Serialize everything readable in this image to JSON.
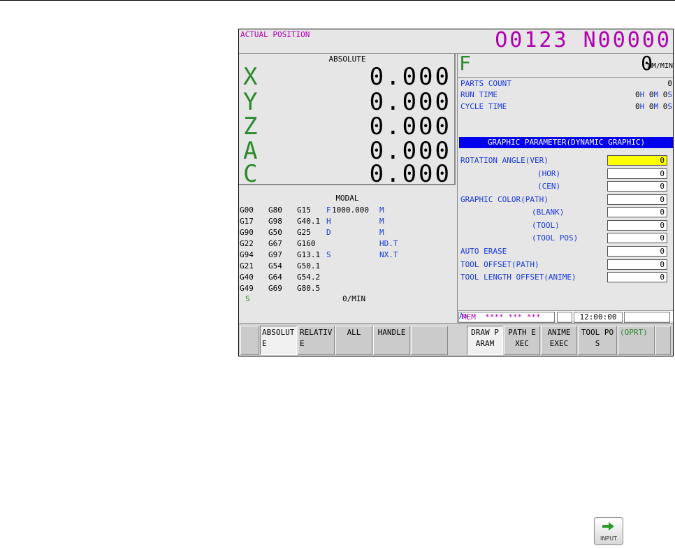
{
  "header": {
    "title": "ACTUAL POSITION",
    "program": "O0123 N00000"
  },
  "absolute": {
    "title": "ABSOLUTE",
    "axes": [
      {
        "name": "X",
        "value": "0.000"
      },
      {
        "name": "Y",
        "value": "0.000"
      },
      {
        "name": "Z",
        "value": "0.000"
      },
      {
        "name": "A",
        "value": "0.000"
      },
      {
        "name": "C",
        "value": "0.000"
      }
    ]
  },
  "modal": {
    "title": "MODAL",
    "rows": [
      [
        "G00",
        "G80",
        "G15"
      ],
      [
        "G17",
        "G98",
        "G40.1"
      ],
      [
        "G90",
        "G50",
        "G25"
      ],
      [
        "G22",
        "G67",
        "G160"
      ],
      [
        "G94",
        "G97",
        "G13.1"
      ],
      [
        "G21",
        "G54",
        "G50.1"
      ],
      [
        "G40",
        "G64",
        "G54.2"
      ],
      [
        "G49",
        "G69",
        "G80.5"
      ]
    ],
    "col4": [
      "F",
      "H",
      "D",
      "",
      "S"
    ],
    "feed_value": "1000.000",
    "col5": [
      "M",
      "M",
      "M",
      "HD.T",
      "NX.T"
    ],
    "s_label": "S",
    "speed_unit": "0/MIN"
  },
  "feed": {
    "label": "F",
    "value": "0",
    "unit": "MM/MIN"
  },
  "info": {
    "parts_count_label": "PARTS COUNT",
    "parts_count_value": "0",
    "run_time_label": "RUN TIME",
    "run_time": {
      "h": "0",
      "m": "0",
      "s": "0"
    },
    "cycle_time_label": "CYCLE TIME",
    "cycle_time": {
      "h": "0",
      "m": "0",
      "s": "0"
    },
    "unit_h": "H",
    "unit_m": "M",
    "unit_s": "S"
  },
  "graphic": {
    "title": "GRAPHIC PARAMETER(DYNAMIC GRAPHIC)",
    "params": [
      {
        "label": "ROTATION ANGLE(VER)",
        "value": "0"
      },
      {
        "label": "(HOR)",
        "value": "0"
      },
      {
        "label": "(CEN)",
        "value": "0"
      },
      {
        "label": "GRAPHIC COLOR(PATH)",
        "value": "0"
      },
      {
        "label": "(BLANK)",
        "value": "0"
      },
      {
        "label": "(TOOL)",
        "value": "0"
      },
      {
        "label": "(TOOL POS)",
        "value": "0"
      },
      {
        "label": "AUTO ERASE",
        "value": "0"
      },
      {
        "label": "TOOL OFFSET(PATH)",
        "value": "0"
      },
      {
        "label": "TOOL LENGTH OFFSET(ANIME)",
        "value": "0"
      }
    ]
  },
  "command": {
    "prompt": "A>"
  },
  "status": {
    "mode": "MEM",
    "stars": "**** *** ***",
    "time": "12:00:00"
  },
  "softkeys": {
    "left": [
      "ABSOLUTE",
      "RELATIVE",
      "ALL",
      "HANDLE"
    ],
    "right": [
      "DRAW PARAM",
      "PATH EXEC",
      "ANIME EXEC",
      "TOOL POS",
      "(OPRT)"
    ]
  },
  "input_key": {
    "label": "INPUT"
  },
  "colors": {
    "magenta": "#b000b0",
    "green": "#2a8a2a",
    "blue": "#1a3ad9",
    "highlight": "#ffff00",
    "title_bar": "#0000ee"
  }
}
